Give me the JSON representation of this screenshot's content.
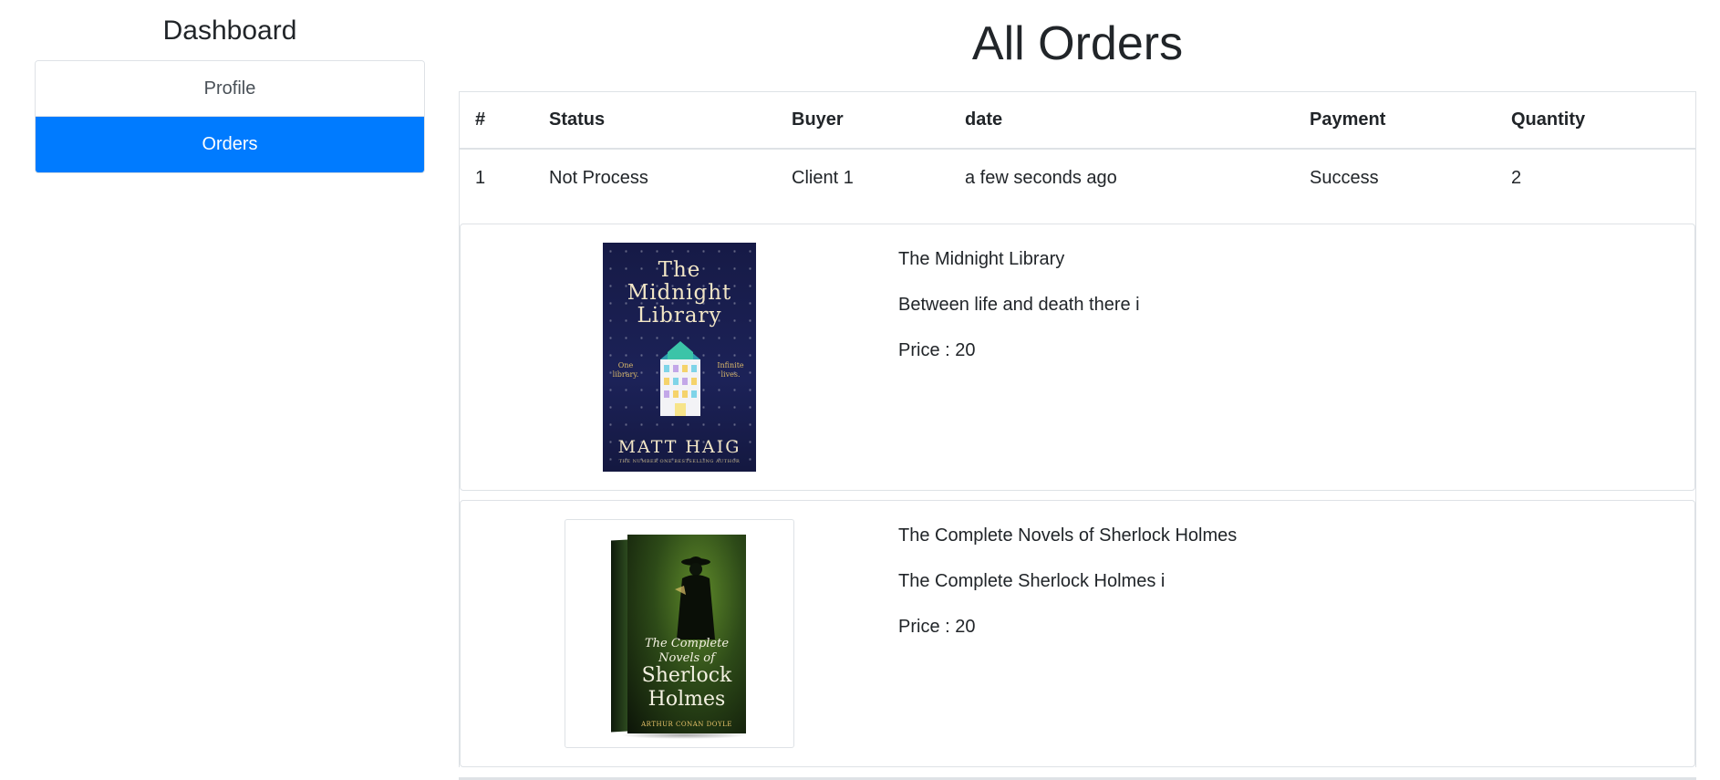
{
  "sidebar": {
    "title": "Dashboard",
    "items": [
      {
        "label": "Profile"
      },
      {
        "label": "Orders"
      }
    ]
  },
  "main": {
    "title": "All Orders",
    "table": {
      "headers": [
        "#",
        "Status",
        "Buyer",
        "date",
        "Payment",
        "Quantity"
      ],
      "rows": [
        {
          "index": "1",
          "status": "Not Process",
          "buyer": "Client 1",
          "date": "a few seconds ago",
          "payment": "Success",
          "quantity": "2"
        }
      ]
    },
    "products": [
      {
        "name": "The Midnight Library",
        "description": "Between life and death there i",
        "price": "Price : 20",
        "cover": {
          "title_lines": [
            "The",
            "Midnight",
            "Library"
          ],
          "tag_left": "One library.",
          "tag_right": "Infinite lives.",
          "author": "MATT HAIG",
          "tagline": "THE NUMBER ONE BESTSELLING AUTHOR"
        }
      },
      {
        "name": "The Complete Novels of Sherlock Holmes",
        "description": "The Complete Sherlock Holmes i",
        "price": "Price : 20",
        "cover": {
          "title_small": "The Complete Novels of",
          "title_large": "Sherlock Holmes",
          "author": "ARTHUR CONAN DOYLE"
        }
      }
    ]
  },
  "colors": {
    "accent": "#007bff",
    "border": "#dee2e6",
    "text": "#212529"
  }
}
